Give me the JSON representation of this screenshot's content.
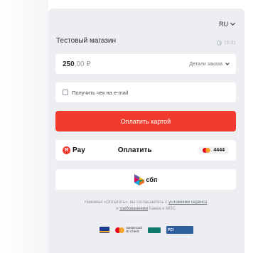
{
  "header": {
    "language": "RU",
    "shop_name": "Тестовый магазин",
    "timer": "19:31"
  },
  "order": {
    "amount_whole": "250",
    "amount_cents": ",00 ₽",
    "details_label": "Детали заказа"
  },
  "receipt": {
    "label": "Получить чек на e-mail",
    "checked": false
  },
  "actions": {
    "pay_card_label": "Оплатить картой",
    "yandex_pay": {
      "logo_letter": "Я",
      "logo_text": "Pay",
      "label": "Оплатить",
      "card_last4": "4444"
    },
    "sbp_label": "сбп"
  },
  "terms": {
    "prefix": "Нажимая «Оплатить», вы соглашаетесь с",
    "link1": "условиями сервиса",
    "middle": "и",
    "link2": "требованиями",
    "suffix": "Банка и МПС"
  },
  "badges": {
    "mastercard_line1": "mastercard",
    "mastercard_line2": "ID Check",
    "pci_text": "PCI"
  },
  "colors": {
    "accent": "#f23b2e",
    "panel_bg": "#eceef1"
  }
}
